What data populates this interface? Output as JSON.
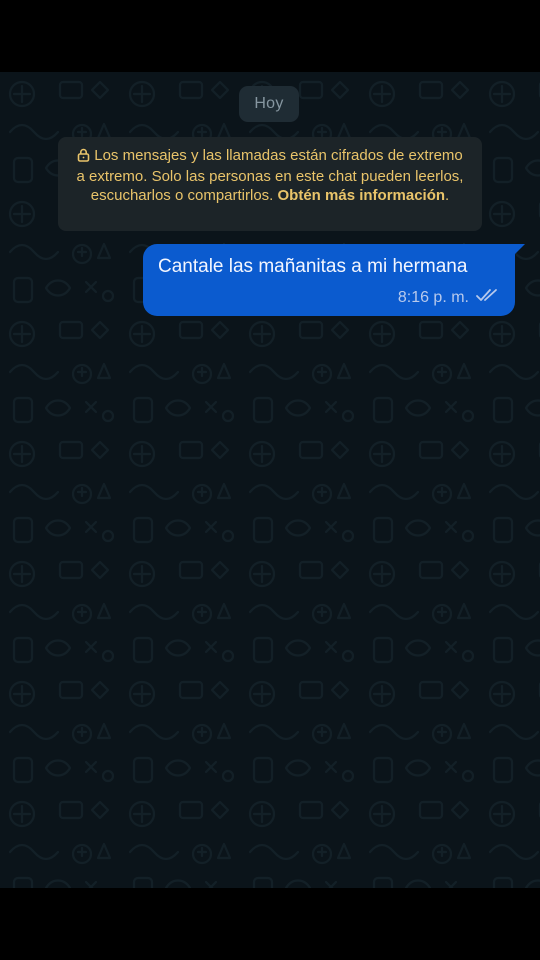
{
  "chat": {
    "date_label": "Hoy",
    "e2e_notice": {
      "text_before": "Los mensajes y las llamadas están cifrados de extremo a extremo. Solo las personas en este chat pueden leerlos, escucharlos o compartirlos. ",
      "link_text": "Obtén más información",
      "text_after": ".",
      "icon": "lock-icon",
      "color": "#e9c46a"
    },
    "messages": [
      {
        "text": "Cantale las mañanitas a mi hermana",
        "time": "8:16 p. m.",
        "status_icon": "double-check-icon",
        "direction": "outgoing",
        "bubble_color": "#0b5bcf"
      }
    ]
  },
  "theme": {
    "chat_background": "#0b141a",
    "bars": "#000000"
  }
}
